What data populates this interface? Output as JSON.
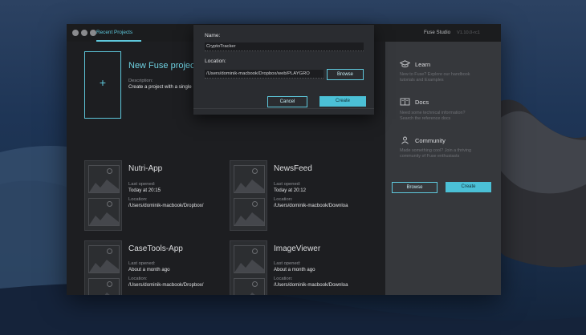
{
  "window": {
    "recent_tab": "Recent Projects",
    "app_title": "Fuse Studio",
    "app_version": "V1.10.0-rc1"
  },
  "new_project": {
    "title": "New Fuse project",
    "description_label": "Description:",
    "description": "Create a project with a single"
  },
  "projects": [
    {
      "name": "Nutri-App",
      "opened_label": "Last opened:",
      "opened": "Today at 20:15",
      "location_label": "Location:",
      "location": "/Users/dominik-macbook/Dropbox/"
    },
    {
      "name": "NewsFeed",
      "opened_label": "Last opened:",
      "opened": "Today at 20:12",
      "location_label": "Location:",
      "location": "/Users/dominik-macbook/Downloa"
    },
    {
      "name": "CaseTools-App",
      "opened_label": "Last opened:",
      "opened": "About a month ago",
      "location_label": "Location:",
      "location": "/Users/dominik-macbook/Dropbox/"
    },
    {
      "name": "ImageViewer",
      "opened_label": "Last opened:",
      "opened": "About a month ago",
      "location_label": "Location:",
      "location": "/Users/dominik-macbook/Downloa"
    }
  ],
  "sidebar": {
    "learn": {
      "title": "Learn",
      "text1": "New to Fuse? Explore our handbook",
      "text2": "tutorials and Examples"
    },
    "docs": {
      "title": "Docs",
      "text1": "Need some technical information?",
      "text2": "Search the reference docs"
    },
    "community": {
      "title": "Community",
      "text1": "Made something cool? Join a thriving",
      "text2": "community of Fuse enthusiasts"
    },
    "browse_label": "Browse",
    "create_label": "Create"
  },
  "dialog": {
    "name_label": "Name:",
    "name_value": "CryptoTracker",
    "location_label": "Location:",
    "location_value": "/Users/dominik-macbook/Dropbox/web/PLAYGRO",
    "browse_label": "Browse",
    "cancel_label": "Cancel",
    "create_label": "Create"
  },
  "colors": {
    "accent": "#5ec8dc",
    "window_bg": "#1d1e21",
    "sidebar_bg": "#36383c",
    "dialog_bg": "#2a2c30"
  },
  "icons": {
    "learn": "graduation-cap-icon",
    "docs": "book-icon",
    "community": "community-icon",
    "new": "plus-icon"
  }
}
